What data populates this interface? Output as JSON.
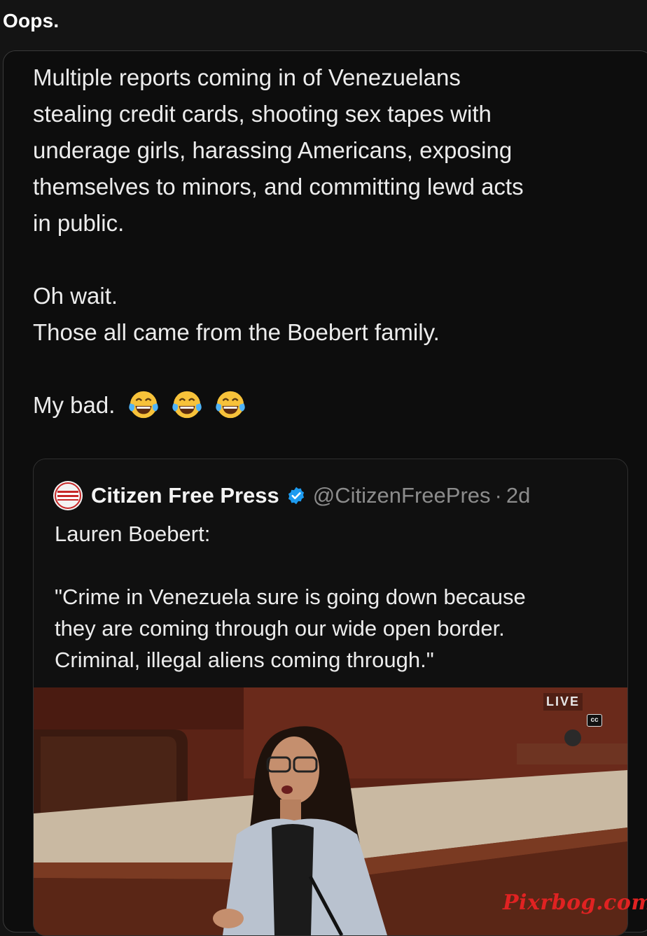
{
  "header": {
    "title": "Oops."
  },
  "post": {
    "lines": [
      "Multiple reports coming in of Venezuelans",
      "stealing credit cards, shooting sex tapes with",
      "underage girls, harassing Americans, exposing",
      "themselves to minors, and committing lewd acts",
      "in public."
    ],
    "line2_1": "Oh wait.",
    "line2_2": "Those all came from the Boebert family.",
    "closing": "My bad.",
    "emojis": [
      "face-with-tears-of-joy-icon",
      "face-with-tears-of-joy-icon",
      "face-with-tears-of-joy-icon"
    ]
  },
  "quoted_post": {
    "display_name": "Citizen Free Press",
    "handle": "@CitizenFreePres",
    "separator": "·",
    "time": "2d",
    "text_line_1": "Lauren Boebert:",
    "quote_lines": [
      "\"Crime in Venezuela sure is going down because",
      "they are coming through our wide open border.",
      "Criminal, illegal aliens coming through.\""
    ],
    "media": {
      "live_label": "LIVE",
      "cc_label": "cc"
    }
  },
  "watermark": "Pixrbog.com",
  "colors": {
    "background": "#141414",
    "verified": "#1d9bf0",
    "watermark": "#e02222"
  }
}
